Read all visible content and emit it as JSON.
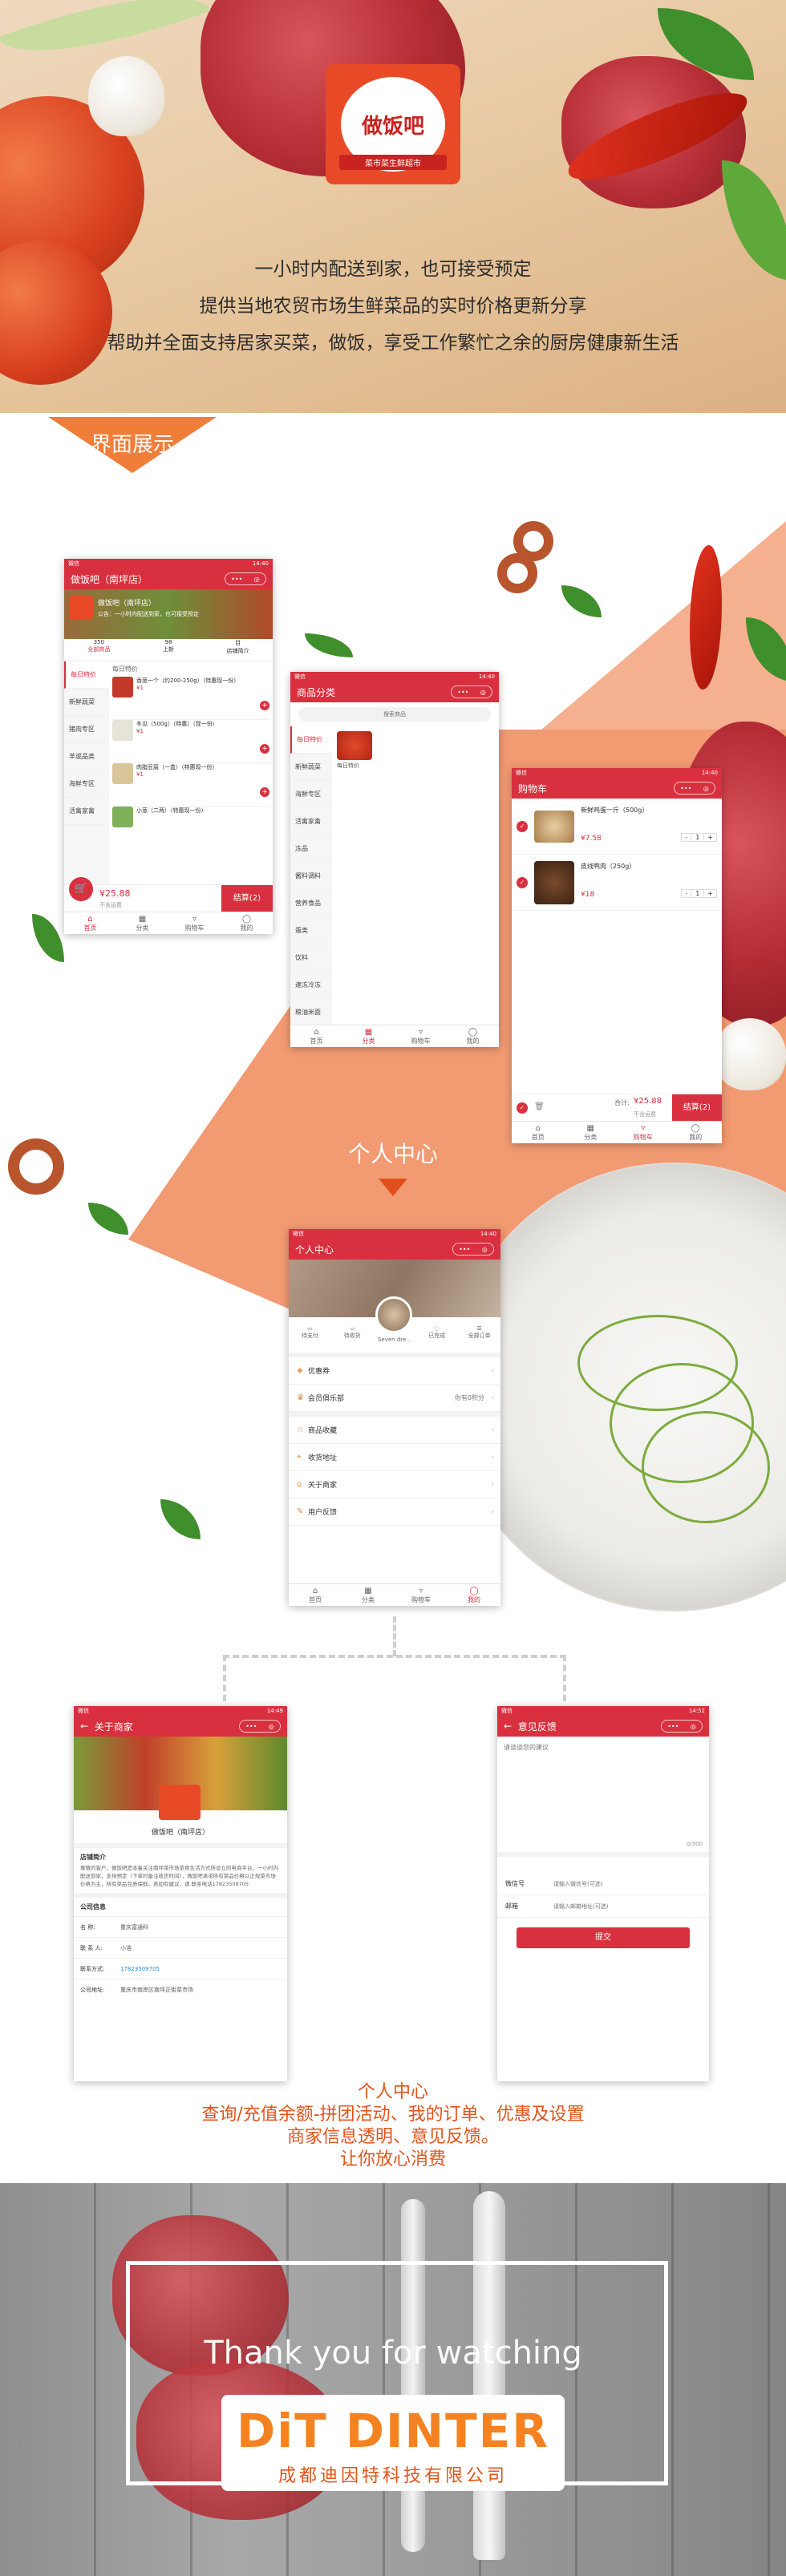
{
  "colors": {
    "brand_red": "#d9303f",
    "accent_orange": "#f07e3a",
    "caption_orange": "#e2541c"
  },
  "hero": {
    "logo_name": "做饭吧",
    "logo_sub": "菜市菜生鲜超市",
    "lines": [
      "一小时内配送到家，也可接受预定",
      "提供当地农贸市场生鲜菜品的实时价格更新分享",
      "帮助并全面支持居家买菜，做饭，享受工作繁忙之余的厨房健康新生活"
    ]
  },
  "banner": {
    "label": "界面展示"
  },
  "status": {
    "time": "14:40",
    "battery": "57%"
  },
  "home": {
    "title": "做饭吧（南坪店）",
    "shop_name": "做饭吧（南坪店）",
    "shop_note": "公告：一小时内配送到家，也可接受预定",
    "stats": [
      {
        "v": "350",
        "l": "全部商品"
      },
      {
        "v": "98",
        "l": "上新"
      },
      {
        "v": "目",
        "l": "店铺简介"
      }
    ],
    "categories": [
      "每日特价",
      "新鲜蔬菜",
      "猪肉专区",
      "羊或品类",
      "海鲜专区",
      "活禽家禽"
    ],
    "products": [
      {
        "name": "香葱一个（约200-250g）（特惠现一份）",
        "price": "¥1"
      },
      {
        "name": "冬瓜（500g）（特惠）（现一份）",
        "price": "¥1"
      },
      {
        "name": "肉脂豆腐（一盒）（特惠现一份）",
        "price": "¥1"
      },
      {
        "name": "小葱（二两）（特惠现一份）",
        "price": ""
      }
    ],
    "section_label": "每日特价",
    "cart_total": "¥25.88",
    "cart_note": "不含运费",
    "checkout": "结算(2)"
  },
  "category": {
    "title": "商品分类",
    "search_placeholder": "搜索商品",
    "items": [
      "每日特价",
      "新鲜蔬菜",
      "海鲜专区",
      "活禽家禽",
      "冻品",
      "酱料调料",
      "营养食品",
      "蛋类",
      "饮料",
      "速冻冷冻",
      "粮油米面"
    ],
    "product": "每日特价"
  },
  "cart": {
    "title": "购物车",
    "items": [
      {
        "name": "新鲜鸡蛋一斤（500g）",
        "price": "¥7.58",
        "qty": "1"
      },
      {
        "name": "皮线鸭肉（250g）",
        "price": "¥18",
        "qty": "1"
      }
    ],
    "total_label": "合计:",
    "total": "¥25.88",
    "total_note": "不含运费",
    "checkout": "结算(2)"
  },
  "tabs": [
    "首页",
    "分类",
    "购物车",
    "我的"
  ],
  "personal": {
    "heading": "个人中心",
    "title": "个人中心",
    "username": "Seven dre...",
    "orders": [
      "待支付",
      "待收货",
      "待评价",
      "已完成",
      "全部订单"
    ],
    "menu": [
      {
        "label": "优惠券",
        "value": ""
      },
      {
        "label": "会员俱乐部",
        "value": "你有0积分"
      },
      {
        "label": "商品收藏",
        "value": ""
      },
      {
        "label": "收货地址",
        "value": ""
      },
      {
        "label": "关于商家",
        "value": ""
      },
      {
        "label": "用户反馈",
        "value": ""
      }
    ]
  },
  "about": {
    "title": "关于商家",
    "time": "14:49",
    "shop": "做饭吧（南坪店）",
    "intro_title": "店铺简介",
    "intro": "尊敬的客户，做饭吧是本着关注南坪菜市场菜食生活方式所设立的电商平台，一小时内配送到家，支持预定（下单时备注收货时间），做饭吧承诺所有菜品价格以正规菜市场价格为主，所有菜品包质保鲜。若如有建议，请 联系电话17823509705",
    "company_title": "公司信息",
    "rows": [
      {
        "k": "名    称:",
        "v": "重庆富通科"
      },
      {
        "k": "联 系 人:",
        "v": "小浩"
      },
      {
        "k": "联系方式:",
        "v": "17823509705"
      },
      {
        "k": "公司地址:",
        "v": "重庆市南岸区南坪正街菜市场"
      }
    ]
  },
  "feedback": {
    "title": "意见反馈",
    "time": "14:52",
    "placeholder": "请谈谈您的建议",
    "counter": "0/300",
    "fields": [
      {
        "label": "微信号",
        "placeholder": "请输入微信号(可选)"
      },
      {
        "label": "邮箱",
        "placeholder": "请输入邮箱地址(可选)"
      }
    ],
    "submit": "提交"
  },
  "caption": [
    "个人中心",
    "查询/充值余额-拼团活动、我的订单、优惠及设置",
    "商家信息透明、意见反馈。",
    "让你放心消费"
  ],
  "footer": {
    "thanks": "Thank you for watching",
    "brand": "DiT DINTER",
    "company": "成都迪因特科技有限公司"
  }
}
